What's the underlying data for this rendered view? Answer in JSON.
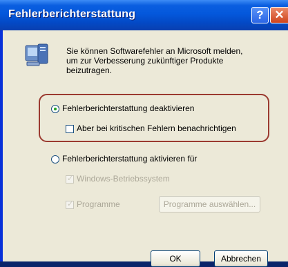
{
  "window": {
    "title": "Fehlerberichterstattung",
    "help_label": "?",
    "close_label": "✕"
  },
  "info": {
    "message": "Sie können Softwarefehler an Microsoft melden, um zur Verbesserung zukünftiger Produkte beizutragen."
  },
  "options": {
    "disable_label": "Fehlerberichterstattung deaktivieren",
    "disable_selected": true,
    "notify_critical_label": "Aber bei kritischen Fehlern benachrichtigen",
    "notify_critical_checked": false,
    "enable_label": "Fehlerberichterstattung aktivieren für",
    "enable_selected": false,
    "windows_label": "Windows-Betriebssystem",
    "windows_checked": true,
    "programs_label": "Programme",
    "programs_checked": true,
    "choose_programs_button": "Programme auswählen..."
  },
  "buttons": {
    "ok": "OK",
    "cancel": "Abbrechen"
  },
  "colors": {
    "titlebar": "#0458dc",
    "dialog_bg": "#ece9d8",
    "highlight_ring": "#9b3a30",
    "radio_dot": "#21a121"
  }
}
